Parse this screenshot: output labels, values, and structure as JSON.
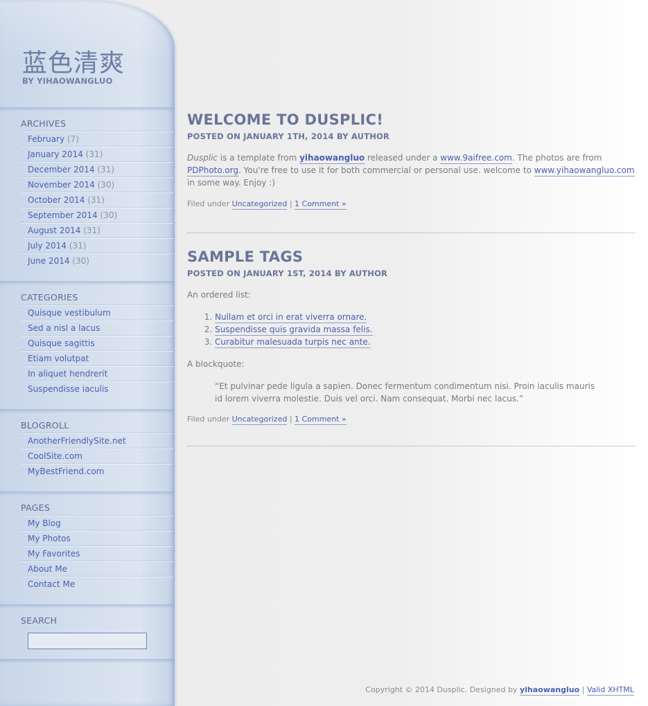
{
  "site": {
    "title": "蓝色清爽",
    "byline": "BY YIHAOWANGLUO"
  },
  "sidebar": {
    "archives": {
      "heading": "ARCHIVES",
      "items": [
        {
          "label": "February",
          "count": "(7)"
        },
        {
          "label": "January 2014",
          "count": "(31)"
        },
        {
          "label": "December 2014",
          "count": "(31)"
        },
        {
          "label": "November 2014",
          "count": "(30)"
        },
        {
          "label": "October 2014",
          "count": "(31)"
        },
        {
          "label": "September 2014",
          "count": "(30)"
        },
        {
          "label": "August 2014",
          "count": "(31)"
        },
        {
          "label": "July 2014",
          "count": "(31)"
        },
        {
          "label": "June 2014",
          "count": "(30)"
        }
      ]
    },
    "categories": {
      "heading": "CATEGORIES",
      "items": [
        "Quisque vestibulum",
        "Sed a nisl a lacus",
        "Quisque sagittis",
        "Etiam volutpat",
        "In aliquet hendrerit",
        "Suspendisse iaculis"
      ]
    },
    "blogroll": {
      "heading": "BLOGROLL",
      "items": [
        "AnotherFriendlySite.net",
        "CoolSite.com",
        "MyBestFriend.com"
      ]
    },
    "pages": {
      "heading": "PAGES",
      "items": [
        "My Blog",
        "My Photos",
        "My Favorites",
        "About Me",
        "Contact Me"
      ]
    },
    "search": {
      "heading": "SEARCH",
      "value": ""
    }
  },
  "posts": [
    {
      "title": "WELCOME TO DUSPLIC!",
      "meta": "POSTED ON JANUARY 1TH, 2014 BY AUTHOR",
      "body": {
        "em": "Dusplic",
        "t1": " is a template from ",
        "link1": "yihaowangluo",
        "t2": " released under a ",
        "link2": "www.9aifree.com",
        "t3": ". The photos are from ",
        "link3": "PDPhoto.org",
        "t4": ". You're free to use it for both commercial or personal use. welcome to ",
        "link4": "www.yihaowangluo.com",
        "t5": " in some way. Enjoy :)"
      },
      "filed_prefix": "Filed under ",
      "category": "Uncategorized",
      "sep": " | ",
      "comments": "1 Comment »"
    },
    {
      "title": "SAMPLE TAGS",
      "meta": "POSTED ON JANUARY 1ST, 2014 BY AUTHOR",
      "ordered_intro": "An ordered list:",
      "list": [
        "Nullam et orci in erat viverra ornare.",
        "Suspendisse quis gravida massa felis.",
        "Curabitur malesuada turpis nec ante."
      ],
      "quote_intro": "A blockquote:",
      "quote": "“Et pulvinar pede ligula a sapien. Donec fermentum condimentum nisi. Proin iaculis mauris id lorem viverra molestie. Duis vel orci. Nam consequat. Morbi nec lacus.”",
      "filed_prefix": "Filed under ",
      "category": "Uncategorized",
      "sep": " | ",
      "comments": "1 Comment »"
    }
  ],
  "footer": {
    "text": "Copyright © 2014 Dusplic. Designed by ",
    "designer": "yihaowangluo",
    "sep": " | ",
    "valid": "Valid XHTML"
  }
}
